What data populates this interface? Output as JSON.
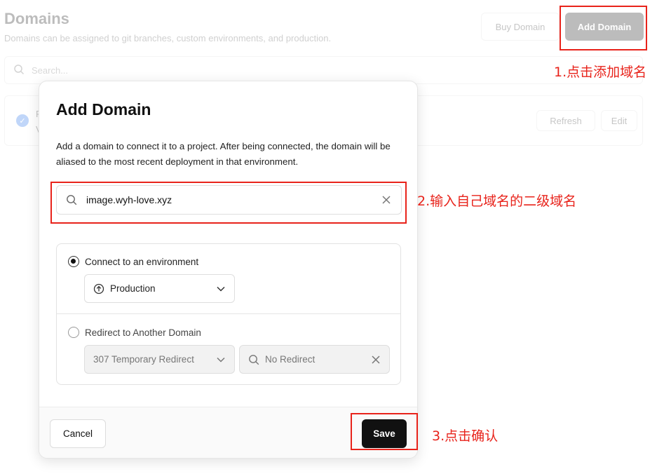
{
  "background": {
    "title": "Domains",
    "subtitle": "Domains can be assigned to git branches, custom environments, and production.",
    "buy_domain_label": "Buy Domain",
    "add_domain_label": "Add Domain",
    "search_placeholder": "Search...",
    "card_letter_1": "P",
    "card_letter_2": "V",
    "refresh_label": "Refresh",
    "edit_label": "Edit"
  },
  "modal": {
    "title": "Add Domain",
    "description": "Add a domain to connect it to a project. After being connected, the domain will be aliased to the most recent deployment in that environment.",
    "domain_value": "image.wyh-love.xyz",
    "option_connect_label": "Connect to an environment",
    "environment_selected": "Production",
    "option_redirect_label": "Redirect to Another Domain",
    "redirect_type_selected": "307 Temporary Redirect",
    "redirect_target_placeholder": "No Redirect",
    "cancel_label": "Cancel",
    "save_label": "Save"
  },
  "annotations": {
    "step1": "1.点击添加域名",
    "step2": "2.输入自己域名的二级域名",
    "step3": "3.点击确认",
    "color": "#e8231b"
  },
  "icons": [
    "search-icon",
    "check-circle-icon",
    "clear-icon",
    "radio-icon",
    "arrow-up-circle-icon",
    "chevron-down-icon"
  ]
}
